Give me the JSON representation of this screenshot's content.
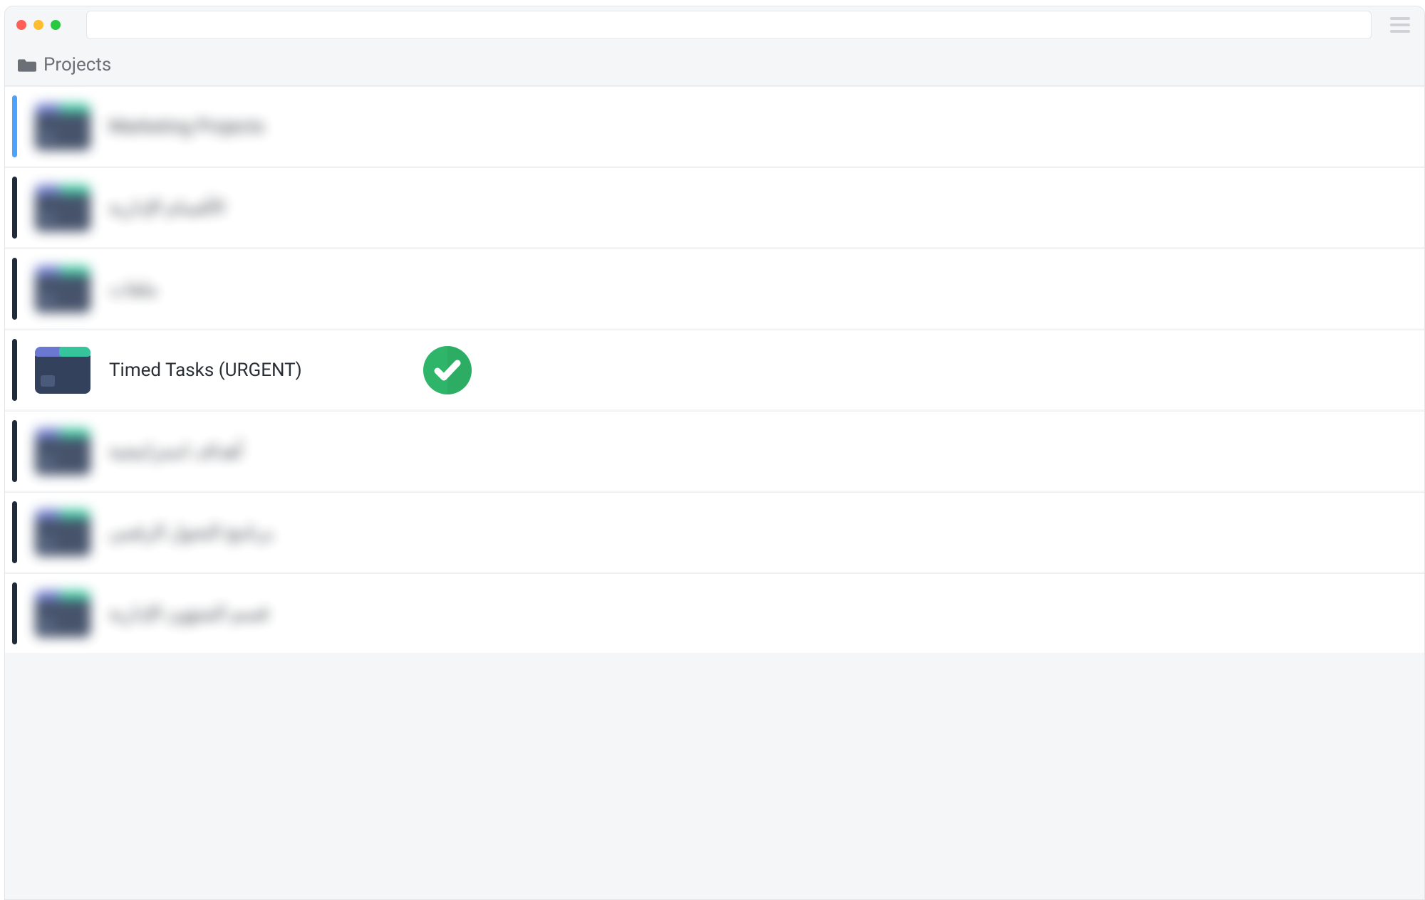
{
  "breadcrumb": {
    "title": "Projects"
  },
  "rows": [
    {
      "label": "Marketing Projects",
      "bar": "blue",
      "blurred": true,
      "checked": false
    },
    {
      "label": "الأقسام الإدارية",
      "bar": "dark",
      "blurred": true,
      "checked": false
    },
    {
      "label": "ملفات",
      "bar": "dark",
      "blurred": true,
      "checked": false
    },
    {
      "label": "Timed Tasks (URGENT)",
      "bar": "dark",
      "blurred": false,
      "checked": true
    },
    {
      "label": "أهداف استراتيجية",
      "bar": "dark",
      "blurred": true,
      "checked": false
    },
    {
      "label": "برنامج التحول الرقمي",
      "bar": "dark",
      "blurred": true,
      "checked": false
    },
    {
      "label": "قسم الشؤون الإدارية",
      "bar": "dark",
      "blurred": true,
      "checked": false
    }
  ],
  "colors": {
    "tile_base": "#33415c",
    "tile_tab_left": "#6a78d1",
    "tile_tab_right": "#35c49b",
    "check_green": "#2fb56a",
    "check_green_dark": "#279853"
  }
}
